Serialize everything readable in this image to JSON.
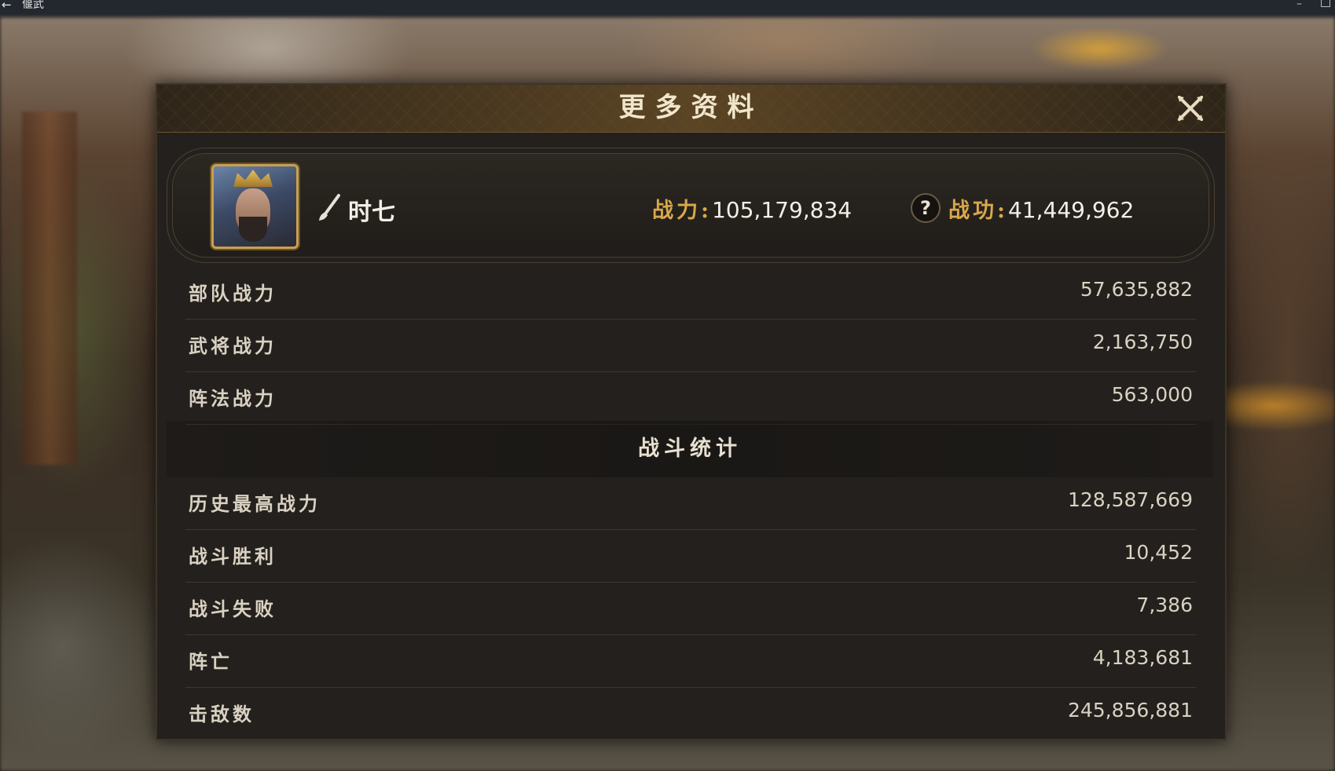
{
  "window": {
    "title": "偃武",
    "back_glyph": "←",
    "minimize_glyph": "–"
  },
  "dialog": {
    "title": "更多资料",
    "close_icon": "close-x-icon"
  },
  "player": {
    "name": "时七",
    "power_label": "战力:",
    "power_value": "105,179,834",
    "merit_label": "战功:",
    "merit_value": "41,449,962",
    "help_glyph": "?"
  },
  "power_breakdown": [
    {
      "label": "部队战力",
      "value": "57,635,882"
    },
    {
      "label": "武将战力",
      "value": "2,163,750"
    },
    {
      "label": "阵法战力",
      "value": "563,000"
    }
  ],
  "battle_stats": {
    "title": "战斗统计",
    "rows": [
      {
        "label": "历史最高战力",
        "value": "128,587,669"
      },
      {
        "label": "战斗胜利",
        "value": "10,452"
      },
      {
        "label": "战斗失败",
        "value": "7,386"
      },
      {
        "label": "阵亡",
        "value": "4,183,681"
      },
      {
        "label": "击敌数",
        "value": "245,856,881"
      }
    ]
  },
  "colors": {
    "gold_label": "#d9a84a",
    "text": "#d9d1c2",
    "panel_bg": "#23201d"
  }
}
